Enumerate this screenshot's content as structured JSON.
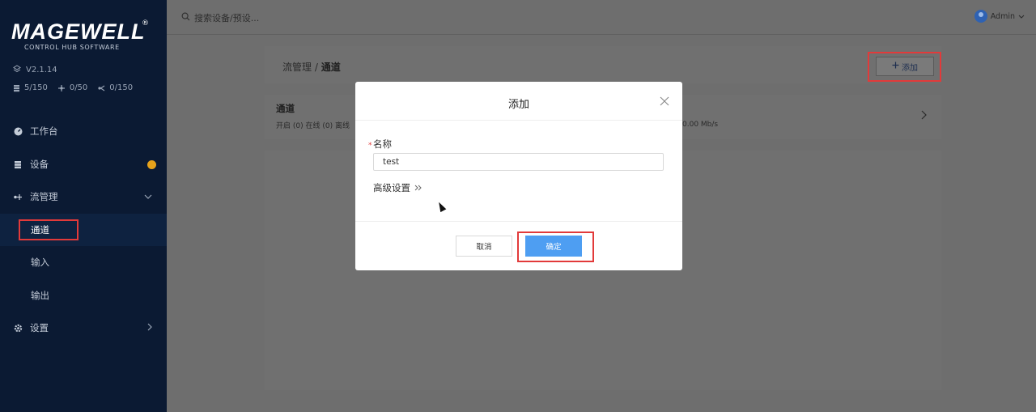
{
  "app": {
    "logo": "MAGEWELL",
    "logo_mark": "®",
    "subtitle": "CONTROL HUB SOFTWARE",
    "version": "V2.1.14",
    "counts": {
      "devices": "5/150",
      "inputs": "0/50",
      "outputs": "0/150"
    }
  },
  "nav": {
    "workbench": "工作台",
    "devices": "设备",
    "stream_mgmt": "流管理",
    "channel": "通道",
    "input": "输入",
    "output": "输出",
    "settings": "设置"
  },
  "topbar": {
    "search_placeholder": "搜索设备/预设...",
    "user": "Admin"
  },
  "content": {
    "breadcrumb_parent": "流管理 / ",
    "breadcrumb_current": "通道",
    "add_label": "添加",
    "channel_title": "通道",
    "channel_stats": "开启 (0)  在线 (0)  离线",
    "channel_rate": "0.00 Mb/s"
  },
  "modal": {
    "title": "添加",
    "name_label": "名称",
    "name_value": "test",
    "advanced_label": "高级设置",
    "cancel_label": "取消",
    "ok_label": "确定"
  },
  "colors": {
    "sidebar_bg": "#0b1a33",
    "primary": "#4e9ef2",
    "highlight": "#e23a3a",
    "badge": "#e6a21b"
  }
}
